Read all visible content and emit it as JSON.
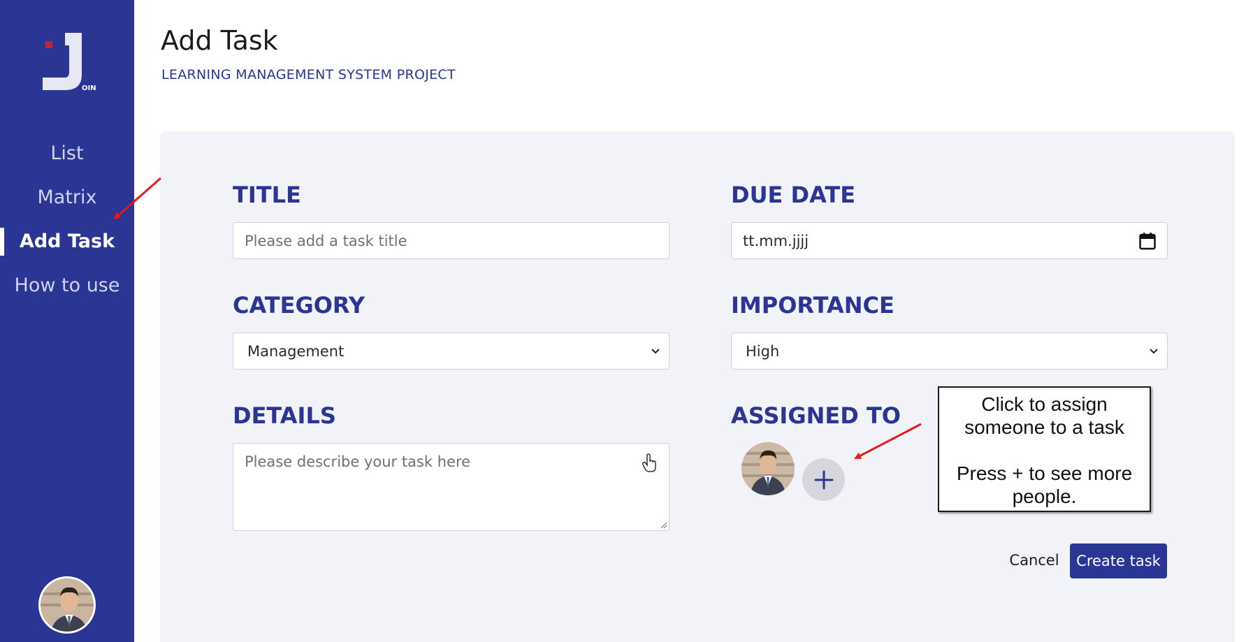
{
  "sidebar": {
    "logo_text": "OIN",
    "items": [
      {
        "label": "List",
        "active": false
      },
      {
        "label": "Matrix",
        "active": false
      },
      {
        "label": "Add Task",
        "active": true
      },
      {
        "label": "How to use",
        "active": false
      }
    ]
  },
  "header": {
    "title": "Add Task",
    "project": "LEARNING MANAGEMENT SYSTEM PROJECT"
  },
  "form": {
    "title_label": "TITLE",
    "title_placeholder": "Please add a task title",
    "due_label": "DUE DATE",
    "due_value": "tt.mm.jjjj",
    "category_label": "CATEGORY",
    "category_value": "Management",
    "importance_label": "IMPORTANCE",
    "importance_value": "High",
    "details_label": "DETAILS",
    "details_placeholder": "Please describe your task here",
    "assigned_label": "ASSIGNED TO",
    "cancel_label": "Cancel",
    "create_label": "Create task"
  },
  "annotation": {
    "line1": "Click to assign",
    "line2": "someone to a task",
    "line3": "Press + to see more",
    "line4": "people."
  },
  "colors": {
    "brand": "#2a3594",
    "panel": "#f2f2f9",
    "arrow": "#e01b1b"
  }
}
